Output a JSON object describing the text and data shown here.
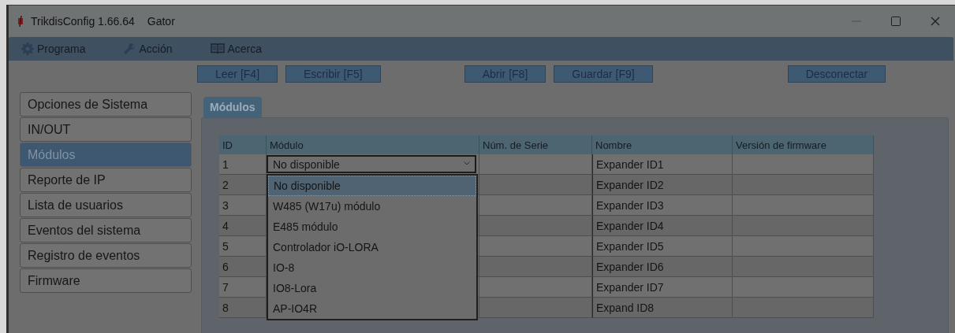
{
  "window": {
    "title": "TrikdisConfig 1.66.64",
    "device": "Gator"
  },
  "menu": [
    "Programa",
    "Acción",
    "Acerca"
  ],
  "toolbar": [
    [
      "Leer [F4]",
      "Escribir [F5]"
    ],
    [
      "Abrir [F8]",
      "Guardar [F9]"
    ],
    [
      "Desconectar"
    ]
  ],
  "sidebar": {
    "items": [
      {
        "label": "Opciones de Sistema",
        "selected": false
      },
      {
        "label": "IN/OUT",
        "selected": false
      },
      {
        "label": "Módulos",
        "selected": true
      },
      {
        "label": "Reporte de IP",
        "selected": false
      },
      {
        "label": "Lista de usuarios",
        "selected": false
      },
      {
        "label": "Eventos del sistema",
        "selected": false
      },
      {
        "label": "Registro de eventos",
        "selected": false
      },
      {
        "label": "Firmware",
        "selected": false
      }
    ]
  },
  "tabs": [
    {
      "label": "Módulos",
      "selected": true
    }
  ],
  "table": {
    "columns": [
      "ID",
      "Módulo",
      "Núm. de Serie",
      "Nombre",
      "Versión de firmware"
    ],
    "rows": [
      {
        "id": "1",
        "name": "Expander ID1"
      },
      {
        "id": "2",
        "name": "Expander ID2"
      },
      {
        "id": "3",
        "name": "Expander ID3"
      },
      {
        "id": "4",
        "name": "Expander ID4"
      },
      {
        "id": "5",
        "name": "Expander ID5"
      },
      {
        "id": "6",
        "name": "Expander ID6"
      },
      {
        "id": "7",
        "name": "Expander ID7"
      },
      {
        "id": "8",
        "name": "Expand ID8"
      }
    ]
  },
  "module_dropdown": {
    "value": "No disponible",
    "expanded": true,
    "options": [
      {
        "label": "No disponible",
        "selected": true
      },
      {
        "label": "W485 (W17u) módulo",
        "selected": false
      },
      {
        "label": "E485 módulo",
        "selected": false
      },
      {
        "label": "Controlador iO-LORA",
        "selected": false
      },
      {
        "label": "IO-8",
        "selected": false
      },
      {
        "label": "IO8-Lora",
        "selected": false
      },
      {
        "label": "AP-IO4R",
        "selected": false
      }
    ]
  }
}
